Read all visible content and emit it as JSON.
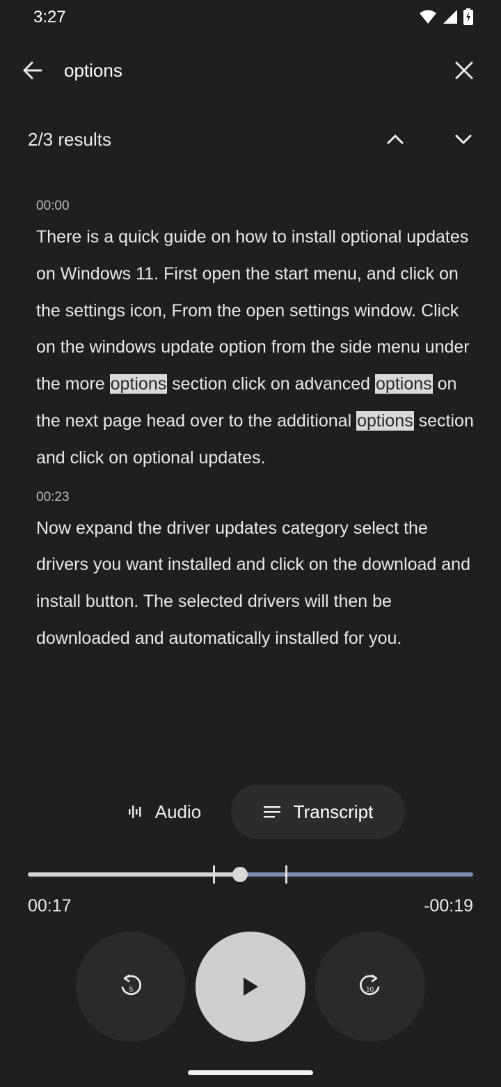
{
  "status_bar": {
    "time": "3:27",
    "icons": [
      "wifi-icon",
      "cellular-signal-icon",
      "battery-charging-icon"
    ]
  },
  "search": {
    "query": "options",
    "back_icon": "arrow-left-icon",
    "clear_icon": "close-icon"
  },
  "results": {
    "count_label": "2/3 results",
    "prev_icon": "chevron-up-icon",
    "next_icon": "chevron-down-icon"
  },
  "transcript": {
    "highlight_term": "options",
    "segments": [
      {
        "time": "00:00",
        "parts": [
          "There is a quick guide on how to install optional updates on Windows 11. First open the start menu, and click on the settings icon, From the open settings window. Click on the windows update option from the side menu under the more ",
          "options",
          " section click on advanced ",
          "options",
          " on the next page head over to the additional ",
          "options",
          " section and click on optional updates."
        ]
      },
      {
        "time": "00:23",
        "text": "Now expand the driver updates category select the drivers you want installed and click on the download and install button. The selected drivers will then be downloaded and automatically installed for you."
      }
    ]
  },
  "tabs": {
    "audio_label": "Audio",
    "audio_icon": "waveform-icon",
    "transcript_label": "Transcript",
    "transcript_icon": "lines-icon",
    "selected": "Transcript"
  },
  "player": {
    "elapsed": "00:17",
    "remaining": "-00:19",
    "progress_fraction": 0.477,
    "rewind_icon": "replay-5-icon",
    "rewind_seconds": "5",
    "play_icon": "play-icon",
    "forward_icon": "forward-10-icon",
    "forward_seconds": "10"
  },
  "colors": {
    "background": "#1f1f1f",
    "highlight": "#d9d9d9",
    "track_played": "#d6d6d6",
    "track_remaining": "#7d8fb3",
    "play_button": "#cfcfcf"
  }
}
